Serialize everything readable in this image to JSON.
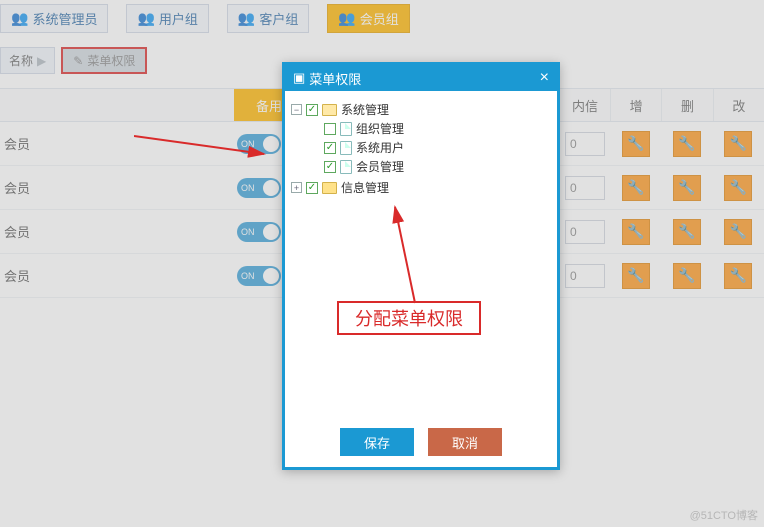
{
  "tabs": [
    {
      "label": "系统管理员"
    },
    {
      "label": "用户组"
    },
    {
      "label": "客户组"
    },
    {
      "label": "会员组"
    }
  ],
  "breadcrumb": {
    "name_label": "名称",
    "arrow": "▶",
    "menu_perm_label": "菜单权限"
  },
  "header": {
    "backup": "备用",
    "internal_msg": "内信",
    "add": "增",
    "delete": "删",
    "modify": "改"
  },
  "rows": [
    {
      "label": "会员",
      "toggle": "ON",
      "msg": "0"
    },
    {
      "label": "会员",
      "toggle": "ON",
      "msg": "0"
    },
    {
      "label": "会员",
      "toggle": "ON",
      "msg": "0"
    },
    {
      "label": "会员",
      "toggle": "ON",
      "msg": "0"
    }
  ],
  "dialog": {
    "title": "菜单权限",
    "tree": {
      "sys_mgmt": "系统管理",
      "org_mgmt": "组织管理",
      "sys_user": "系统用户",
      "member_mgmt": "会员管理",
      "info_mgmt": "信息管理"
    },
    "annotation": "分配菜单权限",
    "save": "保存",
    "cancel": "取消"
  },
  "watermark": "@51CTO博客"
}
